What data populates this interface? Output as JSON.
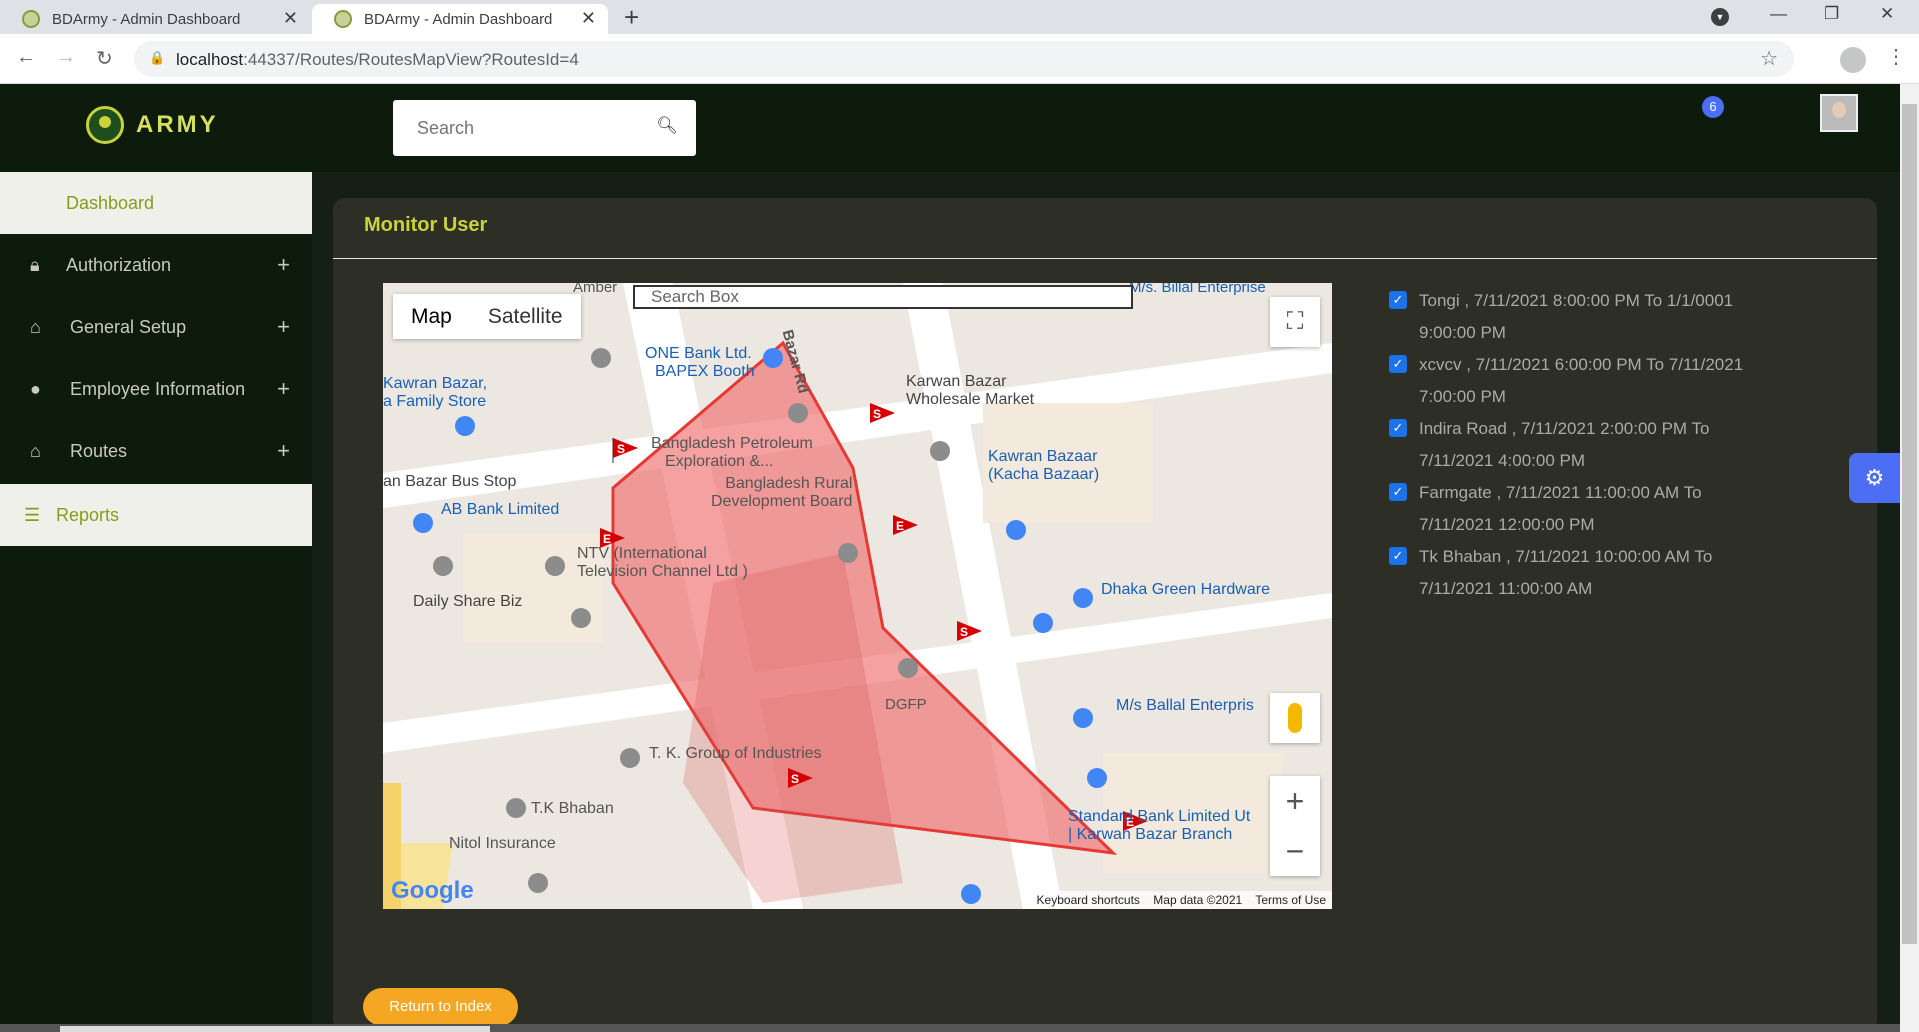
{
  "browser": {
    "tabs": [
      {
        "title": "BDArmy - Admin Dashboard"
      },
      {
        "title": "BDArmy - Admin Dashboard"
      }
    ],
    "url_host": "localhost",
    "url_rest": ":44337/Routes/RoutesMapView?RoutesId=4"
  },
  "header": {
    "logo_text": "ARMY",
    "search_placeholder": "Search",
    "notification_count": "6"
  },
  "sidebar": {
    "items": [
      {
        "label": "Dashboard"
      },
      {
        "label": "Authorization"
      },
      {
        "label": "General Setup"
      },
      {
        "label": "Employee Information"
      },
      {
        "label": "Routes"
      },
      {
        "label": "Reports"
      }
    ]
  },
  "main": {
    "title": "Monitor User",
    "return_button": "Return to Index"
  },
  "map": {
    "type_map": "Map",
    "type_satellite": "Satellite",
    "search_placeholder": "Search Box",
    "footer_shortcuts": "Keyboard shortcuts",
    "footer_data": "Map data ©2021",
    "footer_terms": "Terms of Use",
    "google": "Google",
    "labels": [
      "Kawran Bazar,",
      "a Family Store",
      "ONE Bank Ltd.",
      "BAPEX Booth",
      "Karwan Bazar",
      "Wholesale Market",
      "Bangladesh Petroleum",
      "Exploration &...",
      "Bangladesh Rural",
      "Development Board",
      "Kawran Bazaar",
      "(Kacha Bazaar)",
      "an Bazar Bus Stop",
      "AB Bank Limited",
      "NTV (International",
      "Television Channel Ltd )",
      "Daily Share Biz",
      "Dhaka Green Hardware",
      "DGFP",
      "M/s Ballal Enterpris",
      "T. K. Group of Industries",
      "T.K Bhaban",
      "Standard Bank Limited Ut",
      "| Karwan Bazar Branch",
      "Nitol Insurance",
      "Bazar Rd",
      "Amber",
      "M/s. Billal Enterprise"
    ]
  },
  "routes": [
    {
      "line1": "Tongi , 7/11/2021 8:00:00 PM To 1/1/0001",
      "line2": "9:00:00 PM",
      "checked": true
    },
    {
      "line1": "xcvcv , 7/11/2021 6:00:00 PM To 7/11/2021",
      "line2": "7:00:00 PM",
      "checked": true
    },
    {
      "line1": "Indira Road , 7/11/2021 2:00:00 PM To",
      "line2": "7/11/2021 4:00:00 PM",
      "checked": true
    },
    {
      "line1": "Farmgate , 7/11/2021 11:00:00 AM To",
      "line2": "7/11/2021 12:00:00 PM",
      "checked": true
    },
    {
      "line1": "Tk Bhaban , 7/11/2021 10:00:00 AM To",
      "line2": "7/11/2021 11:00:00 AM",
      "checked": true
    }
  ],
  "colors": {
    "accent": "#c8d23a",
    "sidebar_bg": "#0d1b0d",
    "card_bg": "#2d2f27",
    "polygon": "#f08080",
    "button": "#f5a623"
  }
}
